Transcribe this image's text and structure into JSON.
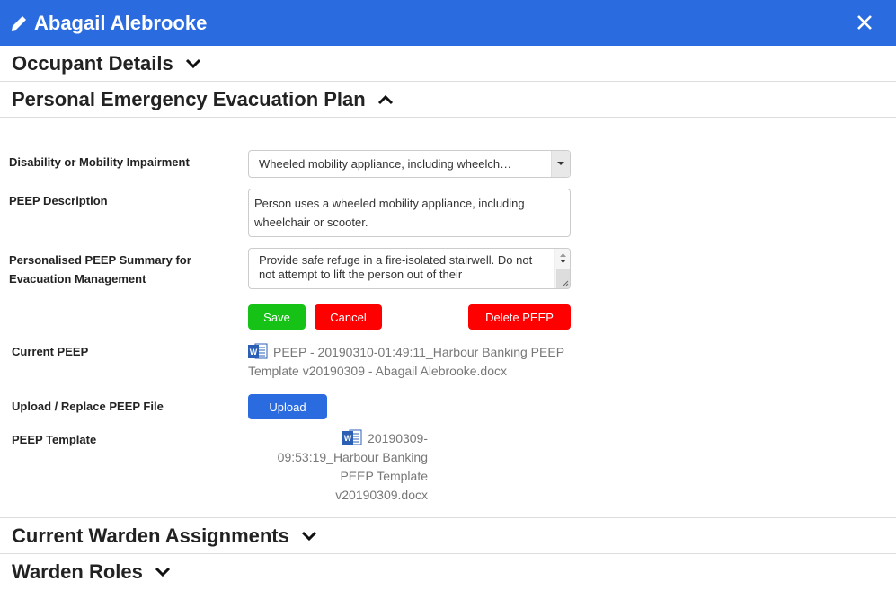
{
  "header": {
    "title": "Abagail Alebrooke",
    "edit_icon": "pencil-icon",
    "close_icon": "close-icon"
  },
  "sections": {
    "occupant_details": "Occupant Details",
    "peep": "Personal Emergency Evacuation Plan",
    "warden_assignments": "Current Warden Assignments",
    "warden_roles": "Warden Roles"
  },
  "peep": {
    "disability_label": "Disability or Mobility Impairment",
    "disability_value": "Wheeled mobility appliance, including wheelch…",
    "description_label": "PEEP Description",
    "description_value": "Person uses a wheeled mobility appliance, including wheelchair or scooter.",
    "summary_label": "Personalised PEEP Summary for Evacuation Management",
    "summary_value": "Provide safe refuge in a fire-isolated stairwell. Do not not attempt to lift the person out of their",
    "save_label": "Save",
    "cancel_label": "Cancel",
    "delete_label": "Delete PEEP",
    "current_label": "Current PEEP",
    "current_file": "PEEP - 20190310-01:49:11_Harbour Banking PEEP Template v20190309 - Abagail Alebrooke.docx",
    "upload_label": "Upload / Replace PEEP File",
    "upload_button": "Upload",
    "template_label": "PEEP Template",
    "template_file_lines": [
      "20190309-",
      "09:53:19_Harbour Banking",
      "PEEP Template",
      "v20190309.docx"
    ]
  },
  "colors": {
    "brand": "#2a6ce0",
    "save": "#17c217",
    "danger": "#ff0000"
  }
}
